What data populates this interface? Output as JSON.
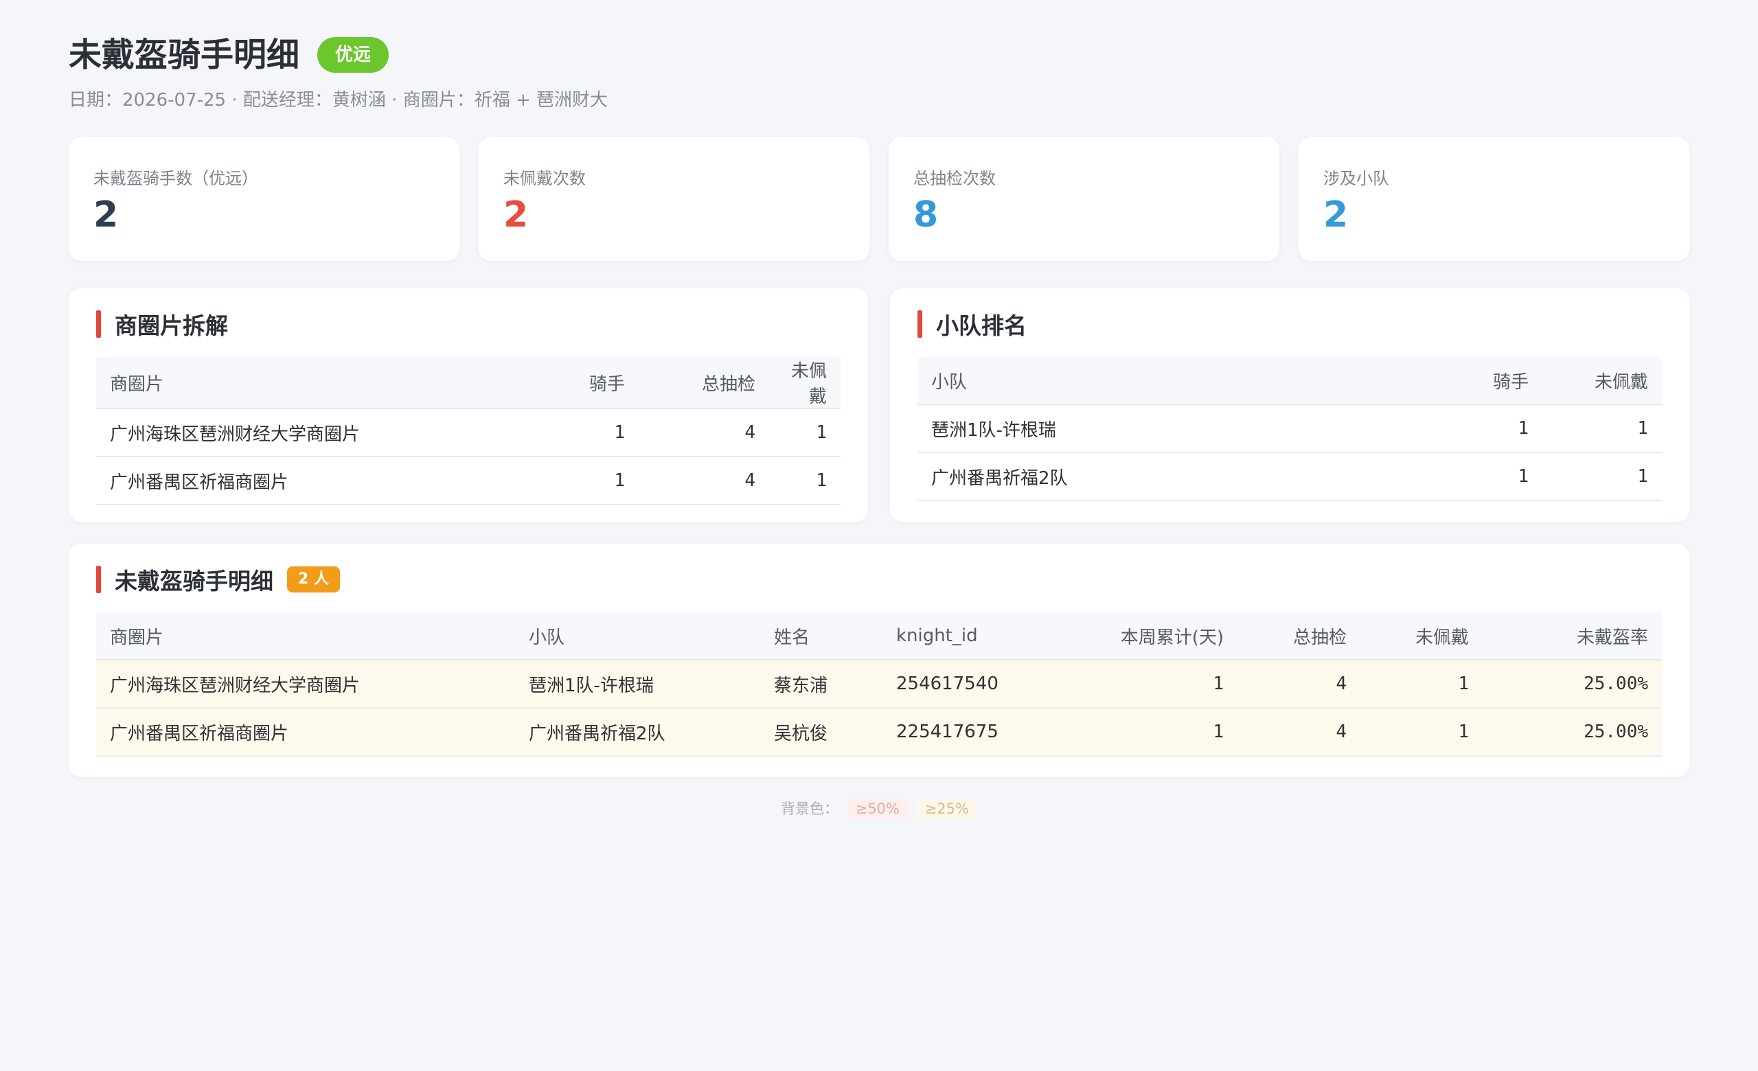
{
  "header": {
    "title": "未戴盔骑手明细",
    "brand_badge": "优远",
    "subtitle": "日期：2026-07-25 · 配送经理：黄树涵 · 商圈片：祈福 + 琶洲财大"
  },
  "kpis": [
    {
      "label": "未戴盔骑手数（优远）",
      "value": "2",
      "color": "#2c3e50"
    },
    {
      "label": "未佩戴次数",
      "value": "2",
      "color": "#e74c3c"
    },
    {
      "label": "总抽检次数",
      "value": "8",
      "color": "#3498db"
    },
    {
      "label": "涉及小队",
      "value": "2",
      "color": "#3498db"
    }
  ],
  "district_breakdown": {
    "title": "商圈片拆解",
    "headers": {
      "district": "商圈片",
      "riders": "骑手",
      "checks": "总抽检",
      "not_worn": "未佩戴"
    },
    "rows": [
      {
        "district": "广州海珠区琶洲财经大学商圈片",
        "riders": "1",
        "checks": "4",
        "not_worn": "1"
      },
      {
        "district": "广州番禺区祈福商圈片",
        "riders": "1",
        "checks": "4",
        "not_worn": "1"
      }
    ]
  },
  "team_ranking": {
    "title": "小队排名",
    "headers": {
      "team": "小队",
      "riders": "骑手",
      "not_worn": "未佩戴"
    },
    "rows": [
      {
        "team": "琶洲1队-许根瑞",
        "riders": "1",
        "not_worn": "1"
      },
      {
        "team": "广州番禺祈福2队",
        "riders": "1",
        "not_worn": "1"
      }
    ]
  },
  "rider_detail": {
    "title": "未戴盔骑手明细",
    "count_badge": "2 人",
    "headers": {
      "district": "商圈片",
      "team": "小队",
      "name": "姓名",
      "knight_id": "knight_id",
      "week_days": "本周累计(天)",
      "checks": "总抽检",
      "not_worn": "未佩戴",
      "rate": "未戴盔率"
    },
    "rows": [
      {
        "district": "广州海珠区琶洲财经大学商圈片",
        "team": "琶洲1队-许根瑞",
        "name": "蔡东浦",
        "knight_id": "254617540",
        "week_days": "1",
        "checks": "4",
        "not_worn": "1",
        "rate": "25.00%"
      },
      {
        "district": "广州番禺区祈福商圈片",
        "team": "广州番禺祈福2队",
        "name": "吴杭俊",
        "knight_id": "225417675",
        "week_days": "1",
        "checks": "4",
        "not_worn": "1",
        "rate": "25.00%"
      }
    ]
  },
  "footer": {
    "legend_label": "背景色：",
    "legend_50": "≥50%",
    "legend_25": "≥25%"
  }
}
